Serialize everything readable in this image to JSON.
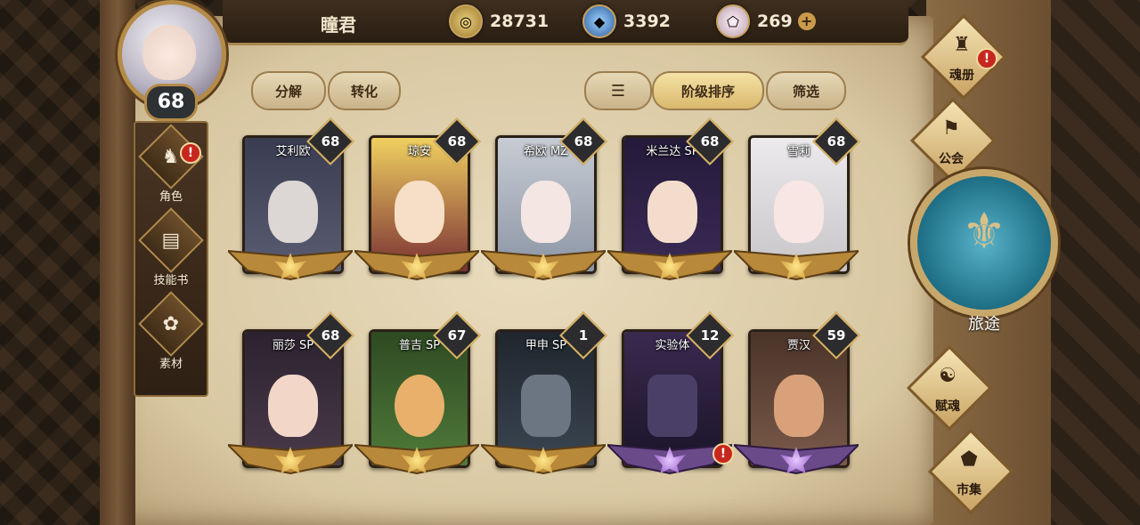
{
  "player": {
    "name": "瞳君",
    "level": "68"
  },
  "currencies": [
    {
      "icon": "gold-coin-icon",
      "value": "28731",
      "color": "#c9a24a"
    },
    {
      "icon": "blue-crystal-icon",
      "value": "3392",
      "color": "#4f8fd1"
    },
    {
      "icon": "pink-gem-icon",
      "value": "269",
      "color": "#e6c8d8"
    }
  ],
  "side_menu": [
    {
      "label": "角色",
      "icon": "character-icon",
      "alert": "!"
    },
    {
      "label": "技能书",
      "icon": "skill-book-icon"
    },
    {
      "label": "素材",
      "icon": "materials-icon"
    }
  ],
  "toolbar": {
    "decompose": "分解",
    "convert": "转化",
    "sort_rank": "阶级排序",
    "filter": "筛选"
  },
  "cards": [
    {
      "name": "艾利欧",
      "level": "68",
      "rank": "gold",
      "art": "#5a5d72",
      "skin": "#dcd6d4"
    },
    {
      "name": "琼安",
      "level": "68",
      "rank": "gold",
      "art": "#7a3034",
      "skin": "#f6dfc6"
    },
    {
      "name": "希欧 MZ",
      "level": "68",
      "rank": "gold",
      "art": "#8b95a4",
      "skin": "#f4e6e2"
    },
    {
      "name": "米兰达 SP",
      "level": "68",
      "rank": "gold",
      "art": "#3a2a55",
      "skin": "#f3dccb"
    },
    {
      "name": "雪莉",
      "level": "68",
      "rank": "gold",
      "art": "#c8c5c8",
      "skin": "#f7e6e3"
    },
    {
      "name": "丽莎 SP",
      "level": "68",
      "rank": "gold",
      "art": "#4a3a4a",
      "skin": "#f2d6c8"
    },
    {
      "name": "普吉 SP",
      "level": "67",
      "rank": "gold",
      "art": "#4f7a3a",
      "skin": "#e8b06a"
    },
    {
      "name": "甲申 SP",
      "level": "1",
      "rank": "gold",
      "art": "#3b4652",
      "skin": "#6c7682"
    },
    {
      "name": "实验体",
      "level": "12",
      "rank": "purple",
      "art": "#2a2238",
      "skin": "#4a3f66",
      "alert": "!"
    },
    {
      "name": "贾汉",
      "level": "59",
      "rank": "purple",
      "art": "#7a5a4a",
      "skin": "#d9a17a"
    }
  ],
  "right_nav": [
    {
      "label": "魂册",
      "icon": "soul-book-icon",
      "alert": "!"
    },
    {
      "label": "公会",
      "icon": "guild-icon"
    },
    {
      "label": "赋魂",
      "icon": "endow-soul-icon"
    },
    {
      "label": "市集",
      "icon": "market-icon"
    }
  ],
  "journey": {
    "label": "旅途"
  }
}
